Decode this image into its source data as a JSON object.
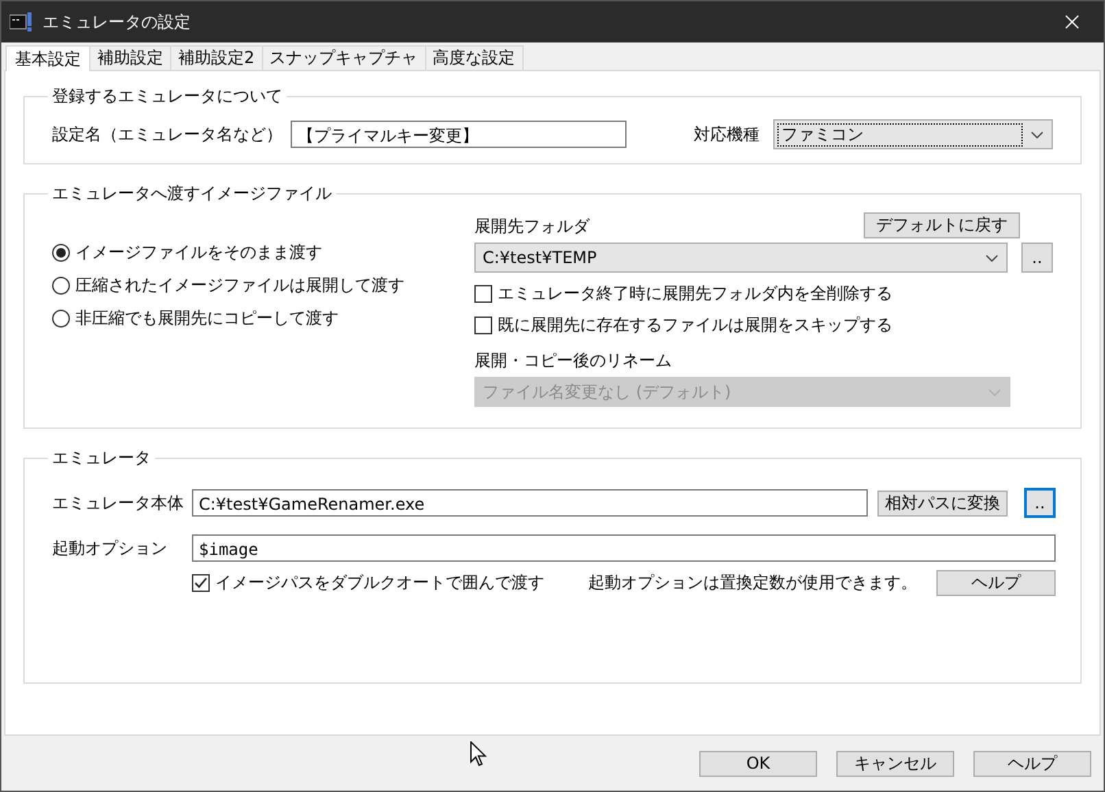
{
  "window": {
    "title": "エミュレータの設定"
  },
  "tabs": [
    {
      "label": "基本設定",
      "selected": true
    },
    {
      "label": "補助設定",
      "selected": false
    },
    {
      "label": "補助設定2",
      "selected": false
    },
    {
      "label": "スナップキャプチャ",
      "selected": false
    },
    {
      "label": "高度な設定",
      "selected": false
    }
  ],
  "registration": {
    "legend": "登録するエミュレータについて",
    "name_label": "設定名（エミュレータ名など）",
    "name_value": "【プライマルキー変更】",
    "platform_label": "対応機種",
    "platform_value": "ファミコン",
    "platform_focused": true
  },
  "image_file": {
    "legend": "エミュレータへ渡すイメージファイル",
    "options": [
      {
        "label": "イメージファイルをそのまま渡す",
        "selected": true
      },
      {
        "label": "圧縮されたイメージファイルは展開して渡す",
        "selected": false
      },
      {
        "label": "非圧縮でも展開先にコピーして渡す",
        "selected": false
      }
    ],
    "folder_label": "展開先フォルダ",
    "reset_button": "デフォルトに戻す",
    "folder_value": "C:¥test¥TEMP",
    "browse_button": "..",
    "checkboxes": [
      {
        "label": "エミュレータ終了時に展開先フォルダ内を全削除する",
        "checked": false
      },
      {
        "label": "既に展開先に存在するファイルは展開をスキップする",
        "checked": false
      }
    ],
    "rename_label": "展開・コピー後のリネーム",
    "rename_value": "ファイル名変更なし (デフォルト)",
    "rename_disabled": true
  },
  "emulator": {
    "legend": "エミュレータ",
    "path_label": "エミュレータ本体",
    "path_value": "C:¥test¥GameRenamer.exe",
    "relative_button": "相対パスに変換",
    "browse_button": "..",
    "browse_focused": true,
    "options_label": "起動オプション",
    "options_value": "$image",
    "quote_checkbox": {
      "label": "イメージパスをダブルクオートで囲んで渡す",
      "checked": true
    },
    "note": "起動オプションは置換定数が使用できます。",
    "help_button": "ヘルプ"
  },
  "buttons": [
    {
      "label": "OK"
    },
    {
      "label": "キャンセル"
    },
    {
      "label": "ヘルプ"
    }
  ]
}
